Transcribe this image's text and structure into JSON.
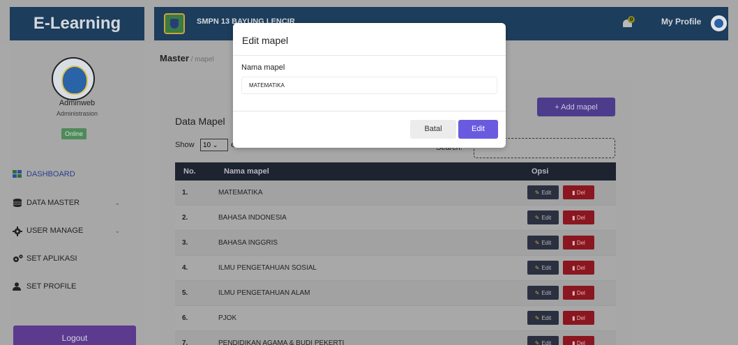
{
  "header": {
    "brand": "E-Learning",
    "school_name": "SMPN 13 BAYUNG LENCIR",
    "notification_count": "0",
    "profile_label": "My Profile"
  },
  "sidebar": {
    "user_name": "Adminweb",
    "user_role": "Administrasion",
    "status": "Online",
    "items": [
      {
        "label": "DASHBOARD",
        "icon": "dashboard-icon"
      },
      {
        "label": "DATA MASTER",
        "icon": "database-icon"
      },
      {
        "label": "USER MANAGE",
        "icon": "gear-icon"
      },
      {
        "label": "SET APLIKASI",
        "icon": "cogs-icon"
      },
      {
        "label": "SET PROFILE",
        "icon": "user-icon"
      }
    ],
    "logout_label": "Logout"
  },
  "breadcrumb": {
    "main": "Master",
    "separator": " / ",
    "sub": "mapel"
  },
  "content": {
    "add_button": "+ Add mapel",
    "title": "Data Mapel",
    "show_label": "Show",
    "show_value": "10",
    "entries_label": "entries",
    "search_label": "Search:",
    "table": {
      "headers": [
        "No.",
        "Nama mapel",
        "Opsi"
      ],
      "edit_label": "Edit",
      "del_label": "Del",
      "rows": [
        {
          "no": "1.",
          "name": "MATEMATIKA"
        },
        {
          "no": "2.",
          "name": "BAHASA INDONESIA"
        },
        {
          "no": "3.",
          "name": "BAHASA INGGRIS"
        },
        {
          "no": "4.",
          "name": "ILMU PENGETAHUAN SOSIAL"
        },
        {
          "no": "5.",
          "name": "ILMU PENGETAHUAN ALAM"
        },
        {
          "no": "6.",
          "name": "PJOK"
        },
        {
          "no": "7.",
          "name": "PENDIDIKAN AGAMA & BUDI PEKERTI"
        }
      ]
    }
  },
  "modal": {
    "title": "Edit mapel",
    "field_label": "Nama mapel",
    "field_value": "MATEMATIKA",
    "cancel_label": "Batal",
    "submit_label": "Edit"
  },
  "colors": {
    "brand_navy": "#1c3d5b",
    "accent_purple": "#6a5ae0",
    "danger_red": "#8a1620"
  }
}
